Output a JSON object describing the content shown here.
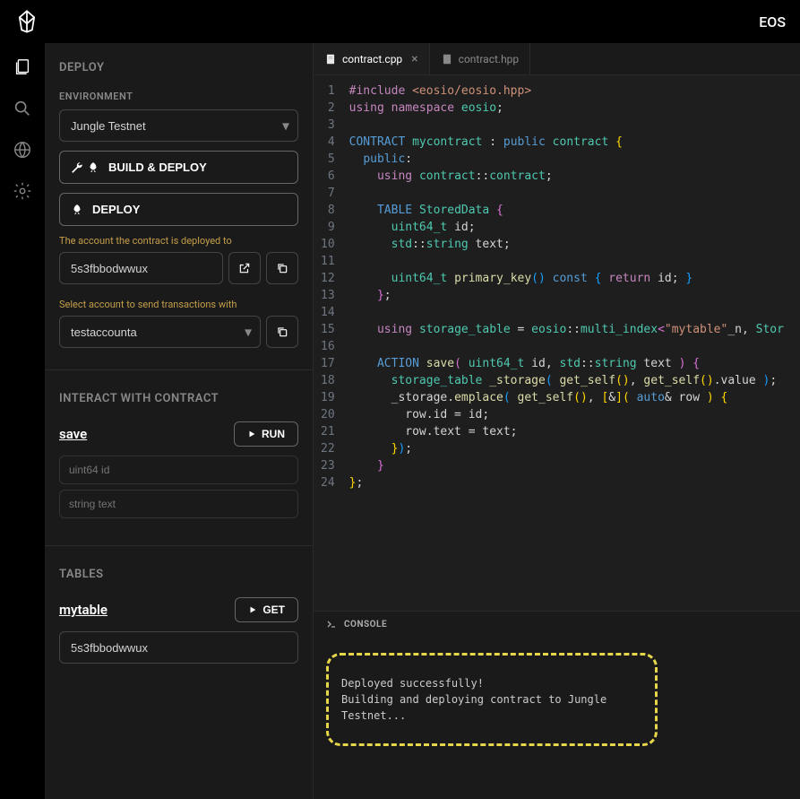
{
  "topbar": {
    "right_text": "EOS"
  },
  "sidebar": {
    "deploy_title": "DEPLOY",
    "environment_label": "ENVIRONMENT",
    "environment_value": "Jungle Testnet",
    "build_deploy_label": "BUILD & DEPLOY",
    "deploy_label": "DEPLOY",
    "account_deployed_label": "The account the contract is deployed to",
    "account_deployed_value": "5s3fbbodwwux",
    "send_tx_label": "Select account to send transactions with",
    "send_tx_value": "testaccounta",
    "interact_title": "INTERACT WITH CONTRACT",
    "action_name": "save",
    "run_label": "RUN",
    "params": [
      {
        "placeholder": "uint64 id"
      },
      {
        "placeholder": "string text"
      }
    ],
    "tables_title": "TABLES",
    "table_name": "mytable",
    "get_label": "GET",
    "table_account_value": "5s3fbbodwwux"
  },
  "editor": {
    "tabs": [
      {
        "name": "contract.cpp",
        "active": true
      },
      {
        "name": "contract.hpp",
        "active": false
      }
    ],
    "code_lines": [
      "#include <eosio/eosio.hpp>",
      "using namespace eosio;",
      "",
      "CONTRACT mycontract : public contract {",
      "  public:",
      "    using contract::contract;",
      "",
      "    TABLE StoredData {",
      "      uint64_t id;",
      "      std::string text;",
      "",
      "      uint64_t primary_key() const { return id; }",
      "    };",
      "",
      "    using storage_table = eosio::multi_index<\"mytable\"_n, StoredData>;",
      "",
      "    ACTION save( uint64_t id, std::string text ) {",
      "      storage_table _storage( get_self(), get_self().value );",
      "      _storage.emplace( get_self(), [&]( auto& row ) {",
      "        row.id = id;",
      "        row.text = text;",
      "      });",
      "    }",
      "};"
    ]
  },
  "console": {
    "title": "CONSOLE",
    "lines": [
      "Deployed successfully!",
      "Building and deploying contract to Jungle Testnet..."
    ]
  }
}
